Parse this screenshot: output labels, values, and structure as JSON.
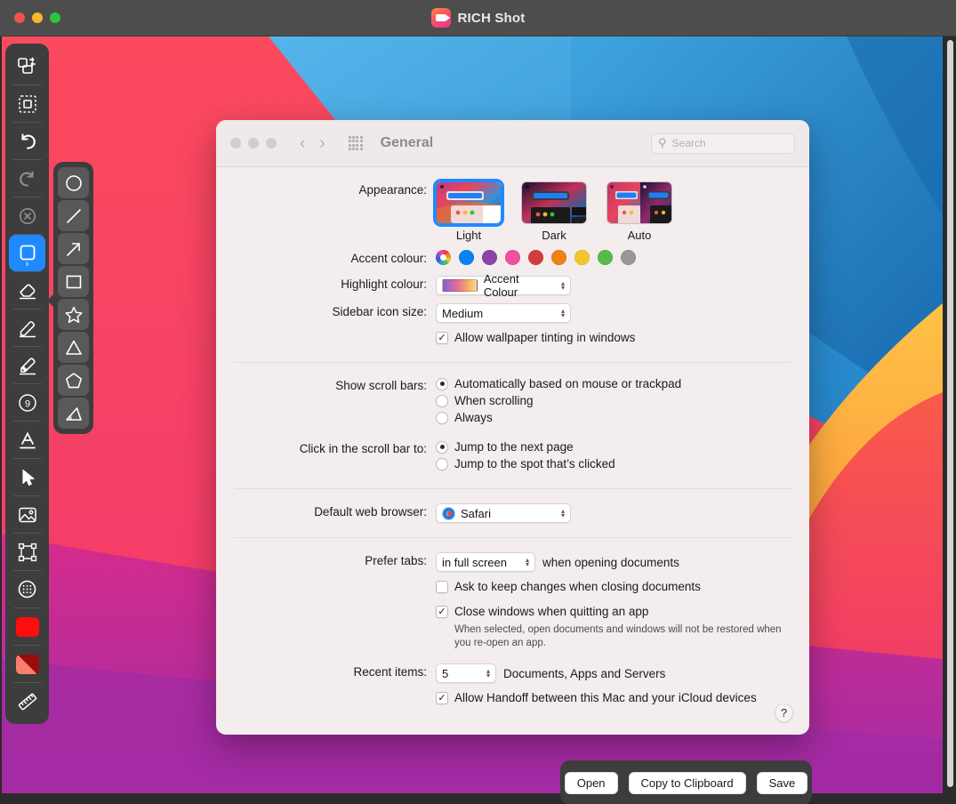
{
  "app": {
    "title": "RICH Shot",
    "icon": "video-camera-icon",
    "traffic_lights": [
      "close",
      "minimise",
      "zoom"
    ]
  },
  "tool_palette": {
    "items": [
      {
        "name": "duplicate-shape-tool",
        "icon": "duplicate-icon",
        "state": "normal"
      },
      {
        "name": "marquee-select-tool",
        "icon": "dashed-square-icon",
        "state": "normal"
      },
      {
        "name": "undo-tool",
        "icon": "undo-arrow-icon",
        "state": "normal"
      },
      {
        "name": "redo-tool",
        "icon": "redo-arrow-icon",
        "state": "disabled"
      },
      {
        "name": "clear-tool",
        "icon": "circle-x-icon",
        "state": "disabled"
      },
      {
        "name": "shapes-tool",
        "icon": "rounded-square-icon",
        "state": "active"
      },
      {
        "name": "eraser-tool",
        "icon": "eraser-icon",
        "state": "normal"
      },
      {
        "name": "pencil-tool",
        "icon": "pencil-icon",
        "state": "normal"
      },
      {
        "name": "marker-tool",
        "icon": "marker-pen-icon",
        "state": "normal"
      },
      {
        "name": "counter-tool",
        "icon": "numbered-badge-icon",
        "label": "9",
        "state": "normal"
      },
      {
        "name": "text-tool",
        "icon": "letter-a-icon",
        "state": "normal"
      },
      {
        "name": "pointer-tool",
        "icon": "cursor-arrow-icon",
        "state": "normal"
      },
      {
        "name": "image-tool",
        "icon": "picture-icon",
        "state": "normal"
      },
      {
        "name": "crop-tool",
        "icon": "crop-handles-icon",
        "state": "normal"
      },
      {
        "name": "blur-tool",
        "icon": "blur-dots-circle-icon",
        "state": "normal"
      },
      {
        "name": "fill-colour-swatch",
        "icon": "solid-colour-swatch",
        "colour": "#fd0d0d"
      },
      {
        "name": "stroke-fill-swatch",
        "icon": "split-colour-swatch",
        "colours": [
          "#9a0c0c",
          "#fa7d6e"
        ]
      },
      {
        "name": "measure-tool",
        "icon": "ruler-icon",
        "state": "normal"
      }
    ]
  },
  "shapes_flyout": {
    "items": [
      {
        "name": "ellipse-shape",
        "icon": "circle-icon"
      },
      {
        "name": "line-shape",
        "icon": "line-icon"
      },
      {
        "name": "arrow-shape",
        "icon": "arrow-icon"
      },
      {
        "name": "rectangle-shape",
        "icon": "square-icon"
      },
      {
        "name": "star-shape",
        "icon": "star-icon"
      },
      {
        "name": "triangle-shape",
        "icon": "triangle-icon"
      },
      {
        "name": "pentagon-shape",
        "icon": "pentagon-icon"
      },
      {
        "name": "angle-shape",
        "icon": "angle-icon"
      }
    ]
  },
  "annotation": {
    "shape": "ellipse",
    "stroke_colour": "#fb2200",
    "fill_colour": "rgba(250,80,60,0.72)"
  },
  "prefs": {
    "title": "General",
    "nav": {
      "back": "‹",
      "forward": "›",
      "grid": "show-all-icon"
    },
    "search": {
      "value": "",
      "placeholder": "Search"
    },
    "appearance": {
      "label": "Appearance:",
      "options": [
        {
          "label": "Light",
          "selected": true
        },
        {
          "label": "Dark",
          "selected": false
        },
        {
          "label": "Auto",
          "selected": false
        }
      ]
    },
    "accent_colour": {
      "label": "Accent colour:",
      "selected_index": 0,
      "swatches": [
        {
          "name": "multicolour",
          "colour": "multi"
        },
        {
          "name": "blue",
          "colour": "#0a82f5"
        },
        {
          "name": "purple",
          "colour": "#8b43ab"
        },
        {
          "name": "pink",
          "colour": "#f0509f"
        },
        {
          "name": "red",
          "colour": "#d23c40"
        },
        {
          "name": "orange",
          "colour": "#ef8115"
        },
        {
          "name": "yellow",
          "colour": "#f6c52c"
        },
        {
          "name": "green",
          "colour": "#57bb4c"
        },
        {
          "name": "graphite",
          "colour": "#979797"
        }
      ]
    },
    "highlight_colour": {
      "label": "Highlight colour:",
      "value": "Accent Colour"
    },
    "sidebar_icon_size": {
      "label": "Sidebar icon size:",
      "value": "Medium"
    },
    "wallpaper_tinting": {
      "label": "Allow wallpaper tinting in windows",
      "checked": true
    },
    "show_scroll_bars": {
      "label": "Show scroll bars:",
      "options": [
        {
          "label": "Automatically based on mouse or trackpad",
          "selected": true
        },
        {
          "label": "When scrolling",
          "selected": false
        },
        {
          "label": "Always",
          "selected": false
        }
      ]
    },
    "click_scroll_bar": {
      "label": "Click in the scroll bar to:",
      "options": [
        {
          "label": "Jump to the next page",
          "selected": true
        },
        {
          "label": "Jump to the spot that’s clicked",
          "selected": false
        }
      ]
    },
    "default_web_browser": {
      "label": "Default web browser:",
      "value": "Safari"
    },
    "prefer_tabs": {
      "label": "Prefer tabs:",
      "value": "in full screen",
      "suffix": "when opening documents"
    },
    "ask_keep_changes": {
      "label": "Ask to keep changes when closing documents",
      "checked": false
    },
    "close_windows": {
      "label": "Close windows when quitting an app",
      "checked": true,
      "hint": "When selected, open documents and windows will not be restored when you re-open an app."
    },
    "recent_items": {
      "label": "Recent items:",
      "value": "5",
      "suffix": "Documents, Apps and Servers"
    },
    "handoff": {
      "label": "Allow Handoff between this Mac and your iCloud devices",
      "checked": true
    },
    "help": "?"
  },
  "action_bar": {
    "buttons": [
      {
        "name": "open-button",
        "label": "Open"
      },
      {
        "name": "copy-to-clipboard-button",
        "label": "Copy to Clipboard"
      },
      {
        "name": "save-button",
        "label": "Save"
      }
    ]
  },
  "glyphs": {
    "check": "✓",
    "up": "▴",
    "down": "▾",
    "magnifier": "⌕"
  }
}
